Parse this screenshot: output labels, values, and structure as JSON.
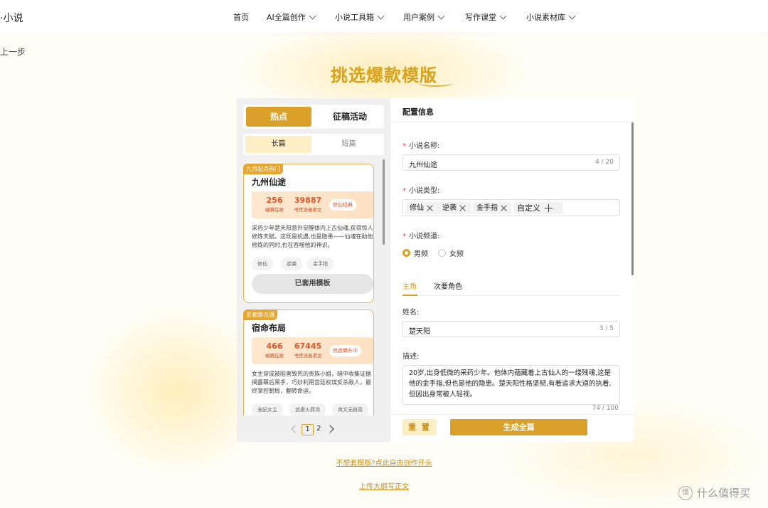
{
  "nav": {
    "brand": "·小说",
    "items": [
      "首页",
      "AI全篇创作",
      "小说工具箱",
      "用户案例",
      "写作课堂",
      "小说素材库"
    ]
  },
  "back": "上一步",
  "page_title": "挑选爆款模版",
  "left": {
    "tabs": [
      "热点",
      "征稿活动"
    ],
    "subtabs": [
      "长篇",
      "短篇"
    ],
    "cards": [
      {
        "badge": "九月起点热门",
        "title": "九州仙途",
        "stat1_num": "256",
        "stat1_label": "编辑在收",
        "stat2_num": "39887",
        "stat2_label": "书荒读者求文",
        "tag": "修仙经典",
        "desc": "采药少年楚天阳意外觉醒体内上古仙魂,获得惊人修炼天赋。这既是机遇,也是隐患——仙魂在助他修炼的同时,也在吞噬他的神识。",
        "chips": [
          "修仙",
          "逆袭",
          "金手指"
        ],
        "button": "已套用模板"
      },
      {
        "badge": "反套路古偶",
        "title": "宿命布局",
        "stat1_num": "466",
        "stat1_label": "编辑在收",
        "stat2_num": "67445",
        "stat2_label": "书荒读者求文",
        "tag": "热度攀升中",
        "desc": "女主穿成被陷害致死的贵族小姐，暗中收集证据揭露幕后黑手，巧妙利用宫廷权谋反杀敌人，最终掌控朝局，翻转命运。",
        "chips": [
          "宠妃女主",
          "追妻火葬场",
          "爽文无雌竞"
        ]
      }
    ],
    "pager": {
      "current": "1",
      "next": "2"
    }
  },
  "right": {
    "header": "配置信息",
    "name_label": "小说名称:",
    "name_value": "九州仙途",
    "name_count": "4 / 20",
    "type_label": "小说类型:",
    "types": [
      "修仙",
      "逆袭",
      "金手指"
    ],
    "custom_label": "自定义",
    "channel_label": "小说频道:",
    "channels": [
      "男频",
      "女频"
    ],
    "role_tabs": [
      "主角",
      "次要角色"
    ],
    "role_name_label": "姓名:",
    "role_name_value": "楚天阳",
    "role_name_count": "3 / 5",
    "role_desc_label": "描述:",
    "role_desc_value": "20岁,出身低微的采药少年。他体内蕴藏着上古仙人的一缕残魂,这是他的金手指,但也是他的隐患。楚天阳性格坚韧,有着追求大道的执着,但因出身常被人轻视。",
    "role_desc_count": "74 / 100",
    "reset_button": "重 置",
    "generate_button": "生成全篇"
  },
  "links": [
    "不想套模板?点此自由创作开头",
    "上传大纲写正文"
  ],
  "watermark": "什么值得买",
  "colors": {
    "accent": "#d9a12a",
    "title": "#d9a21b",
    "stat": "#e0562a"
  }
}
